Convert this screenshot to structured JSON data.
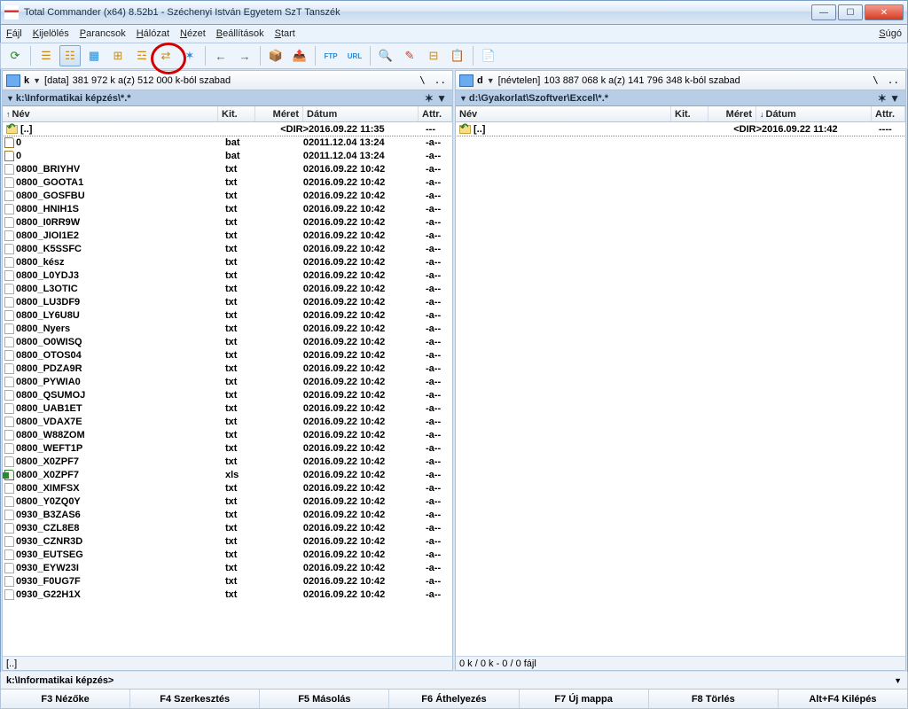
{
  "window": {
    "title": "Total Commander (x64) 8.52b1 - Széchenyi István Egyetem SzT Tanszék"
  },
  "menu": {
    "items": [
      "Fájl",
      "Kijelölés",
      "Parancsok",
      "Hálózat",
      "Nézet",
      "Beállítások",
      "Start"
    ],
    "help": "Súgó"
  },
  "left": {
    "drive_letter": "k",
    "drive_label": "[data]",
    "drive_space": "381 972 k a(z) 512 000 k-ból szabad",
    "path": "k:\\Informatikai képzés\\*.*",
    "columns": {
      "nev": "Név",
      "kit": "Kit.",
      "meret": "Méret",
      "datum": "Dátum",
      "attr": "Attr.",
      "sort": "nev",
      "sort_dir": "↑"
    },
    "status": "[..]",
    "rows": [
      {
        "icon": "up",
        "name": "[..]",
        "kit": "",
        "meret": "<DIR>",
        "datum": "2016.09.22 11:35",
        "attr": "---",
        "sel": true
      },
      {
        "icon": "bat",
        "name": "0",
        "kit": "bat",
        "meret": "0",
        "datum": "2011.12.04 13:24",
        "attr": "-a--"
      },
      {
        "icon": "bat",
        "name": "0",
        "kit": "bat",
        "meret": "0",
        "datum": "2011.12.04 13:24",
        "attr": "-a--"
      },
      {
        "icon": "txt",
        "name": "0800_BRIYHV",
        "kit": "txt",
        "meret": "0",
        "datum": "2016.09.22 10:42",
        "attr": "-a--"
      },
      {
        "icon": "txt",
        "name": "0800_GOOTA1",
        "kit": "txt",
        "meret": "0",
        "datum": "2016.09.22 10:42",
        "attr": "-a--"
      },
      {
        "icon": "txt",
        "name": "0800_GOSFBU",
        "kit": "txt",
        "meret": "0",
        "datum": "2016.09.22 10:42",
        "attr": "-a--"
      },
      {
        "icon": "txt",
        "name": "0800_HNIH1S",
        "kit": "txt",
        "meret": "0",
        "datum": "2016.09.22 10:42",
        "attr": "-a--"
      },
      {
        "icon": "txt",
        "name": "0800_I0RR9W",
        "kit": "txt",
        "meret": "0",
        "datum": "2016.09.22 10:42",
        "attr": "-a--"
      },
      {
        "icon": "txt",
        "name": "0800_JIOI1E2",
        "kit": "txt",
        "meret": "0",
        "datum": "2016.09.22 10:42",
        "attr": "-a--"
      },
      {
        "icon": "txt",
        "name": "0800_K5SSFC",
        "kit": "txt",
        "meret": "0",
        "datum": "2016.09.22 10:42",
        "attr": "-a--"
      },
      {
        "icon": "txt",
        "name": "0800_kész",
        "kit": "txt",
        "meret": "0",
        "datum": "2016.09.22 10:42",
        "attr": "-a--"
      },
      {
        "icon": "txt",
        "name": "0800_L0YDJ3",
        "kit": "txt",
        "meret": "0",
        "datum": "2016.09.22 10:42",
        "attr": "-a--"
      },
      {
        "icon": "txt",
        "name": "0800_L3OTIC",
        "kit": "txt",
        "meret": "0",
        "datum": "2016.09.22 10:42",
        "attr": "-a--"
      },
      {
        "icon": "txt",
        "name": "0800_LU3DF9",
        "kit": "txt",
        "meret": "0",
        "datum": "2016.09.22 10:42",
        "attr": "-a--"
      },
      {
        "icon": "txt",
        "name": "0800_LY6U8U",
        "kit": "txt",
        "meret": "0",
        "datum": "2016.09.22 10:42",
        "attr": "-a--"
      },
      {
        "icon": "txt",
        "name": "0800_Nyers",
        "kit": "txt",
        "meret": "0",
        "datum": "2016.09.22 10:42",
        "attr": "-a--"
      },
      {
        "icon": "txt",
        "name": "0800_O0WISQ",
        "kit": "txt",
        "meret": "0",
        "datum": "2016.09.22 10:42",
        "attr": "-a--"
      },
      {
        "icon": "txt",
        "name": "0800_OTOS04",
        "kit": "txt",
        "meret": "0",
        "datum": "2016.09.22 10:42",
        "attr": "-a--"
      },
      {
        "icon": "txt",
        "name": "0800_PDZA9R",
        "kit": "txt",
        "meret": "0",
        "datum": "2016.09.22 10:42",
        "attr": "-a--"
      },
      {
        "icon": "txt",
        "name": "0800_PYWIA0",
        "kit": "txt",
        "meret": "0",
        "datum": "2016.09.22 10:42",
        "attr": "-a--"
      },
      {
        "icon": "txt",
        "name": "0800_QSUMOJ",
        "kit": "txt",
        "meret": "0",
        "datum": "2016.09.22 10:42",
        "attr": "-a--"
      },
      {
        "icon": "txt",
        "name": "0800_UAB1ET",
        "kit": "txt",
        "meret": "0",
        "datum": "2016.09.22 10:42",
        "attr": "-a--"
      },
      {
        "icon": "txt",
        "name": "0800_VDAX7E",
        "kit": "txt",
        "meret": "0",
        "datum": "2016.09.22 10:42",
        "attr": "-a--"
      },
      {
        "icon": "txt",
        "name": "0800_W88ZOM",
        "kit": "txt",
        "meret": "0",
        "datum": "2016.09.22 10:42",
        "attr": "-a--"
      },
      {
        "icon": "txt",
        "name": "0800_WEFT1P",
        "kit": "txt",
        "meret": "0",
        "datum": "2016.09.22 10:42",
        "attr": "-a--"
      },
      {
        "icon": "txt",
        "name": "0800_X0ZPF7",
        "kit": "txt",
        "meret": "0",
        "datum": "2016.09.22 10:42",
        "attr": "-a--"
      },
      {
        "icon": "xls",
        "name": "0800_X0ZPF7",
        "kit": "xls",
        "meret": "0",
        "datum": "2016.09.22 10:42",
        "attr": "-a--"
      },
      {
        "icon": "txt",
        "name": "0800_XIMFSX",
        "kit": "txt",
        "meret": "0",
        "datum": "2016.09.22 10:42",
        "attr": "-a--"
      },
      {
        "icon": "txt",
        "name": "0800_Y0ZQ0Y",
        "kit": "txt",
        "meret": "0",
        "datum": "2016.09.22 10:42",
        "attr": "-a--"
      },
      {
        "icon": "txt",
        "name": "0930_B3ZAS6",
        "kit": "txt",
        "meret": "0",
        "datum": "2016.09.22 10:42",
        "attr": "-a--"
      },
      {
        "icon": "txt",
        "name": "0930_CZL8E8",
        "kit": "txt",
        "meret": "0",
        "datum": "2016.09.22 10:42",
        "attr": "-a--"
      },
      {
        "icon": "txt",
        "name": "0930_CZNR3D",
        "kit": "txt",
        "meret": "0",
        "datum": "2016.09.22 10:42",
        "attr": "-a--"
      },
      {
        "icon": "txt",
        "name": "0930_EUTSEG",
        "kit": "txt",
        "meret": "0",
        "datum": "2016.09.22 10:42",
        "attr": "-a--"
      },
      {
        "icon": "txt",
        "name": "0930_EYW23I",
        "kit": "txt",
        "meret": "0",
        "datum": "2016.09.22 10:42",
        "attr": "-a--"
      },
      {
        "icon": "txt",
        "name": "0930_F0UG7F",
        "kit": "txt",
        "meret": "0",
        "datum": "2016.09.22 10:42",
        "attr": "-a--"
      },
      {
        "icon": "txt",
        "name": "0930_G22H1X",
        "kit": "txt",
        "meret": "0",
        "datum": "2016.09.22 10:42",
        "attr": "-a--"
      }
    ]
  },
  "right": {
    "drive_letter": "d",
    "drive_label": "[névtelen]",
    "drive_space": "103 887 068 k a(z) 141 796 348 k-ból szabad",
    "path": "d:\\Gyakorlat\\Szoftver\\Excel\\*.*",
    "columns": {
      "nev": "Név",
      "kit": "Kit.",
      "meret": "Méret",
      "datum": "Dátum",
      "attr": "Attr.",
      "sort": "datum",
      "sort_dir": "↓"
    },
    "status": "0 k / 0 k - 0 / 0 fájl",
    "rows": [
      {
        "icon": "up",
        "name": "[..]",
        "kit": "",
        "meret": "<DIR>",
        "datum": "2016.09.22 11:42",
        "attr": "----",
        "sel": true
      }
    ]
  },
  "cmdline": {
    "prompt": "k:\\Informatikai képzés>"
  },
  "fkeys": [
    "F3 Nézőke",
    "F4 Szerkesztés",
    "F5 Másolás",
    "F6 Áthelyezés",
    "F7 Új mappa",
    "F8 Törlés",
    "Alt+F4 Kilépés"
  ]
}
